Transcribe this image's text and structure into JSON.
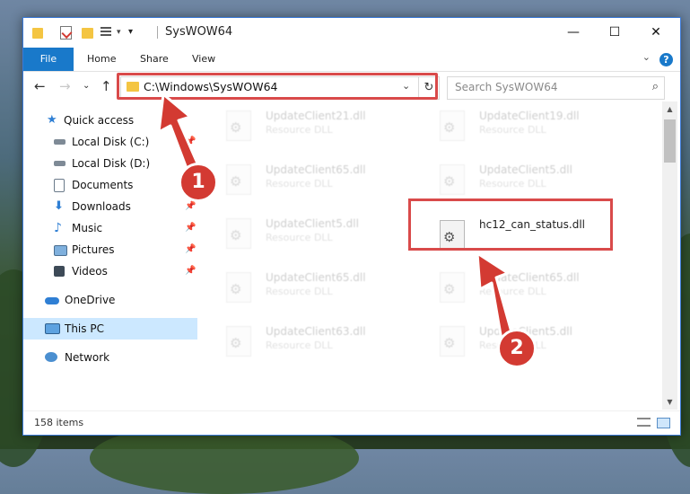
{
  "window": {
    "title": "SysWOW64",
    "controls": {
      "minimize": "—",
      "maximize": "☐",
      "close": "✕"
    }
  },
  "ribbon": {
    "tabs": [
      {
        "label": "File"
      },
      {
        "label": "Home"
      },
      {
        "label": "Share"
      },
      {
        "label": "View"
      }
    ],
    "help": "?"
  },
  "address": {
    "path": "C:\\Windows\\SysWOW64",
    "search_placeholder": "Search SysWOW64"
  },
  "nav_pane": {
    "items": [
      {
        "label": "Quick access",
        "icon": "star-icon",
        "pinned": false
      },
      {
        "label": "Local Disk (C:)",
        "icon": "drive-icon",
        "pinned": true
      },
      {
        "label": "Local Disk (D:)",
        "icon": "drive-icon",
        "pinned": true
      },
      {
        "label": "Documents",
        "icon": "documents-icon",
        "pinned": true
      },
      {
        "label": "Downloads",
        "icon": "download-icon",
        "pinned": true
      },
      {
        "label": "Music",
        "icon": "music-icon",
        "pinned": true
      },
      {
        "label": "Pictures",
        "icon": "pictures-icon",
        "pinned": true
      },
      {
        "label": "Videos",
        "icon": "videos-icon",
        "pinned": true
      },
      {
        "label": "OneDrive",
        "icon": "onedrive-icon",
        "pinned": false
      },
      {
        "label": "This PC",
        "icon": "pc-icon",
        "pinned": false,
        "selected": true
      },
      {
        "label": "Network",
        "icon": "network-icon",
        "pinned": false
      }
    ]
  },
  "files": [
    {
      "name": "UpdateClient21.dll",
      "type": "Resource DLL",
      "faded": true
    },
    {
      "name": "UpdateClient19.dll",
      "type": "Resource DLL",
      "faded": true
    },
    {
      "name": "UpdateClient65.dll",
      "type": "Resource DLL",
      "faded": true
    },
    {
      "name": "UpdateClient5.dll",
      "type": "Resource DLL",
      "faded": true
    },
    {
      "name": "UpdateClient5.dll",
      "type": "Resource DLL",
      "faded": true
    },
    {
      "name": "hc12_can_status.dll",
      "type": "",
      "faded": false
    },
    {
      "name": "UpdateClient65.dll",
      "type": "Resource DLL",
      "faded": true
    },
    {
      "name": "UpdateClient65.dll",
      "type": "Resource DLL",
      "faded": true
    },
    {
      "name": "UpdateClient63.dll",
      "type": "Resource DLL",
      "faded": true
    },
    {
      "name": "UpdateClient5.dll",
      "type": "Resource DLL",
      "faded": true
    }
  ],
  "status": {
    "item_count": "158 items"
  },
  "annotations": {
    "step1": "1",
    "step2": "2",
    "color": "#d33a32"
  },
  "colors": {
    "accent": "#1979ca",
    "highlight": "#d94a4a",
    "selection": "#cce8ff"
  }
}
